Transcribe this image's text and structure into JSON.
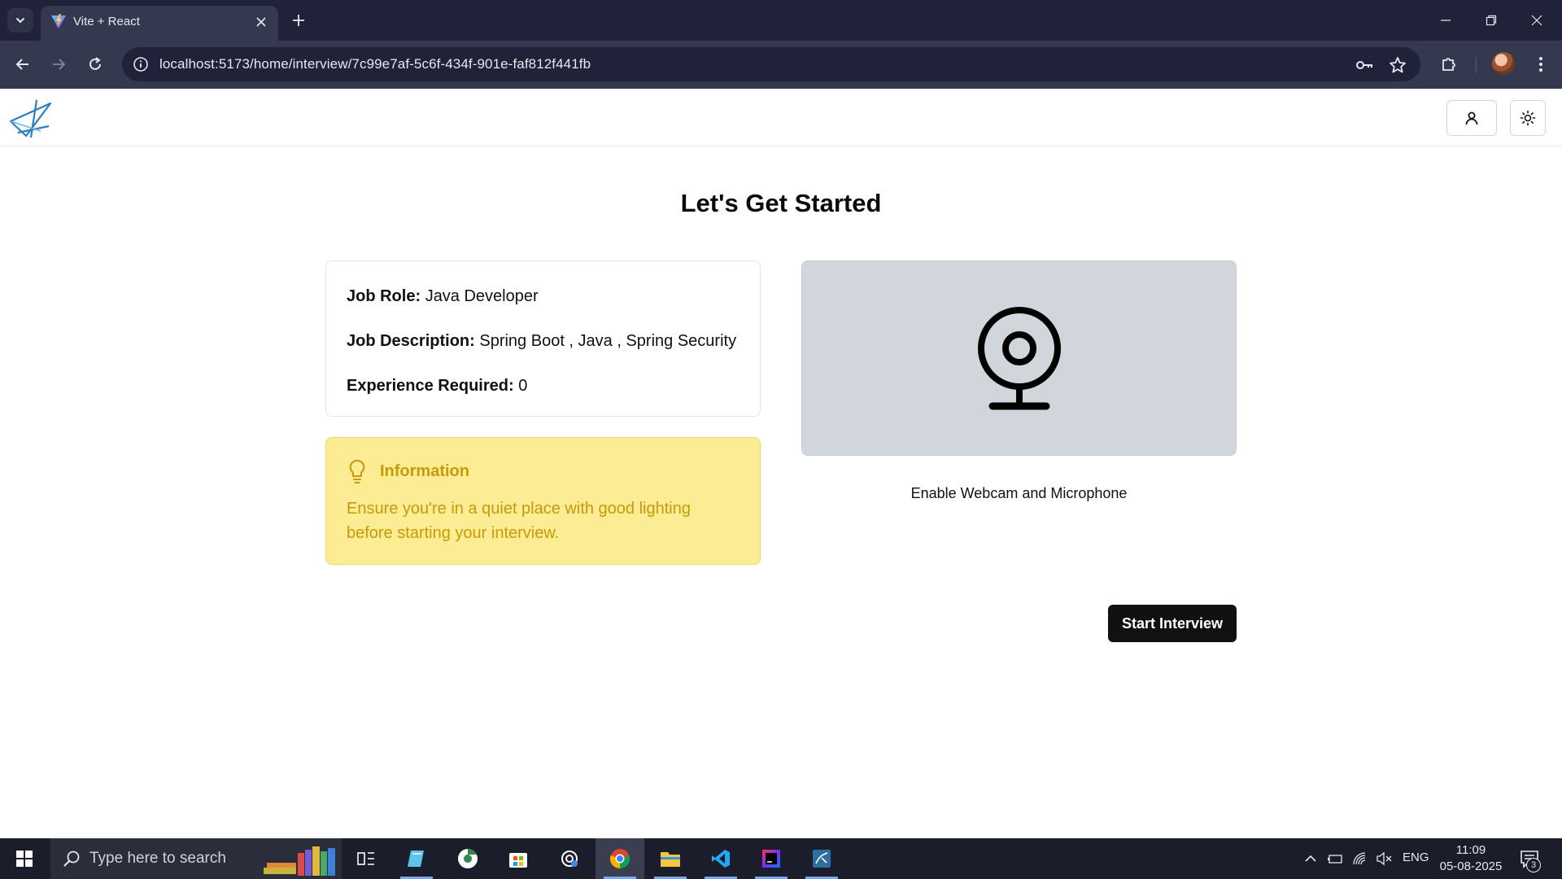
{
  "browser": {
    "tab_title": "Vite + React",
    "url": "localhost:5173/home/interview/7c99e7af-5c6f-434f-901e-faf812f441fb"
  },
  "header": {
    "user_icon": "user-icon",
    "theme_icon": "sun-icon"
  },
  "main": {
    "title": "Let's Get Started",
    "job": {
      "role_label": "Job Role:",
      "role_value": "Java Developer",
      "description_label": "Job Description:",
      "description_value": "Spring Boot , Java , Spring Security",
      "experience_label": "Experience Required:",
      "experience_value": "0"
    },
    "info": {
      "title": "Information",
      "text": "Ensure you're in a quiet place with good lighting before starting your interview."
    },
    "webcam": {
      "label": "Enable Webcam and Microphone"
    },
    "start_button": "Start Interview"
  },
  "taskbar": {
    "search_placeholder": "Type here to search",
    "language": "ENG",
    "time": "11:09",
    "date": "05-08-2025",
    "notification_count": "3"
  },
  "colors": {
    "info_bg": "#fcec93",
    "info_text": "#c99a08",
    "webcam_bg": "#d1d5dc",
    "primary_button": "#111112",
    "chrome_dark": "#1f2238"
  }
}
